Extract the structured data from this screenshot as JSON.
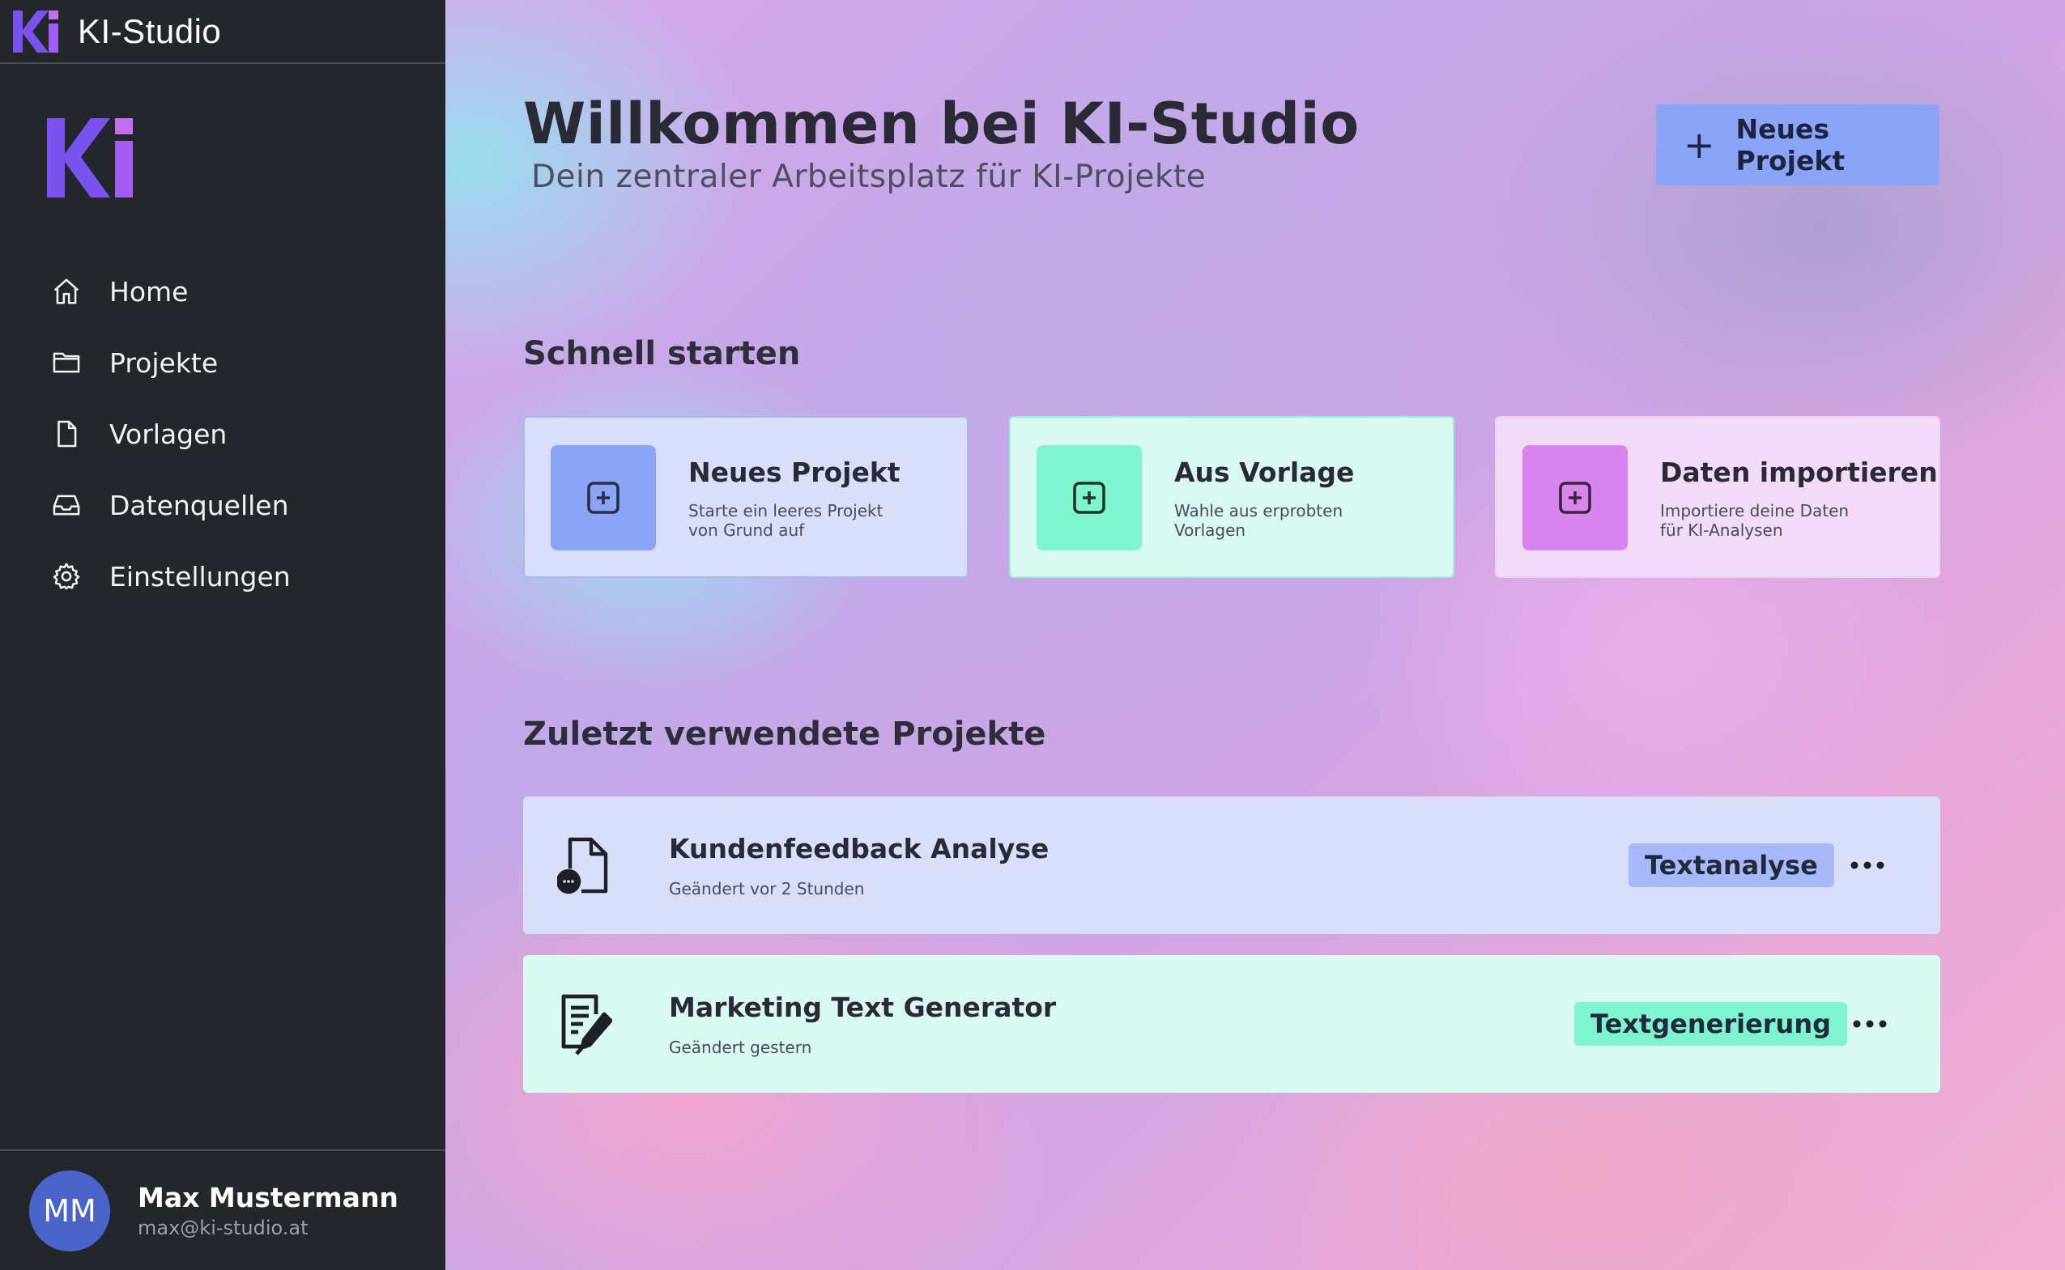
{
  "app": {
    "title": "KI-Studio"
  },
  "sidebar": {
    "items": [
      {
        "label": "Home",
        "icon": "home-icon"
      },
      {
        "label": "Projekte",
        "icon": "folder-icon"
      },
      {
        "label": "Vorlagen",
        "icon": "file-icon"
      },
      {
        "label": "Datenquellen",
        "icon": "inbox-icon"
      },
      {
        "label": "Einstellungen",
        "icon": "gear-icon"
      }
    ]
  },
  "user": {
    "initials": "MM",
    "name": "Max Mustermann",
    "email": "max@ki-studio.at"
  },
  "header": {
    "title": "Willkommen bei KI-Studio",
    "subtitle": "Dein zentraler Arbeitsplatz für KI-Projekte",
    "new_project_button": "Neues Projekt"
  },
  "quick_start": {
    "title": "Schnell starten",
    "cards": [
      {
        "title": "Neues Projekt",
        "line1": "Starte ein leeres Projekt",
        "line2": "von Grund auf",
        "color": "#8aa4f8"
      },
      {
        "title": "Aus Vorlage",
        "line1": "Wahle aus erprobten",
        "line2": "Vorlagen",
        "color": "#7ef5cf"
      },
      {
        "title": "Daten importieren",
        "line1": "Importiere deine Daten",
        "line2": "für KI-Analysen",
        "color": "#d985f0"
      }
    ]
  },
  "recent": {
    "title": "Zuletzt verwendete Projekte",
    "projects": [
      {
        "title": "Kundenfeedback Analyse",
        "modified": "Geändert vor 2 Stunden",
        "tag": "Textanalyse",
        "tag_color": "#a9b8fb",
        "icon": "file-comment-icon"
      },
      {
        "title": "Marketing Text Generator",
        "modified": "Geändert gestern",
        "tag": "Textgenerierung",
        "tag_color": "#7ef5cf",
        "icon": "document-edit-icon"
      }
    ]
  },
  "colors": {
    "sidebar_bg": "#23272b",
    "accent_blue": "#8aa4f8",
    "accent_green": "#7ef5cf",
    "accent_purple": "#d985f0",
    "logo_purple": "#7a52f0"
  }
}
